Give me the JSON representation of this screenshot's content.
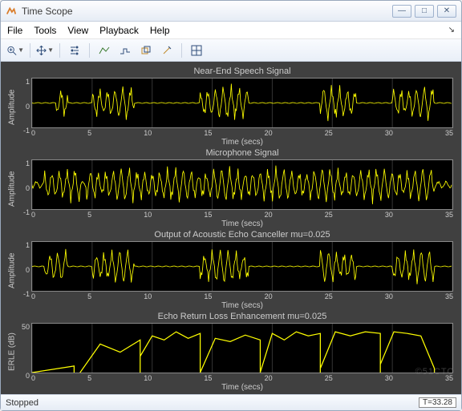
{
  "window": {
    "title": "Time Scope"
  },
  "menu": {
    "file": "File",
    "tools": "Tools",
    "view": "View",
    "playback": "Playback",
    "help": "Help"
  },
  "toolbar_icons": [
    "zoom-in",
    "pan",
    "settings",
    "line-plot",
    "step-plot",
    "overlay",
    "marker",
    "layout-grid"
  ],
  "status": {
    "left": "Stopped",
    "right": "T=33.28"
  },
  "watermark": "©51CTO",
  "xlabel": "Time (secs)",
  "xticks": [
    "0",
    "5",
    "10",
    "15",
    "20",
    "25",
    "30",
    "35"
  ],
  "plots": [
    {
      "title": "Near-End Speech Signal",
      "ylabel": "Amplitude",
      "yticks": [
        "1",
        "0",
        "-1"
      ]
    },
    {
      "title": "Microphone Signal",
      "ylabel": "Amplitude",
      "yticks": [
        "1",
        "0",
        "-1"
      ]
    },
    {
      "title": "Output of Acoustic Echo Canceller mu=0.025",
      "ylabel": "Amplitude",
      "yticks": [
        "1",
        "0",
        "-1"
      ]
    },
    {
      "title": "Echo Return Loss Enhancement mu=0.025",
      "ylabel": "ERLE (dB)",
      "yticks": [
        "50",
        "0"
      ]
    }
  ],
  "chart_data": [
    {
      "type": "line",
      "title": "Near-End Speech Signal",
      "xlabel": "Time (secs)",
      "ylabel": "Amplitude",
      "xlim": [
        0,
        35
      ],
      "ylim": [
        -1.5,
        1.5
      ],
      "x_bursts": [
        [
          2,
          3
        ],
        [
          5,
          8.5
        ],
        [
          14,
          18
        ],
        [
          24,
          27
        ],
        [
          30,
          33.5
        ]
      ],
      "amplitude": 1.0
    },
    {
      "type": "line",
      "title": "Microphone Signal",
      "xlabel": "Time (secs)",
      "ylabel": "Amplitude",
      "xlim": [
        0,
        35
      ],
      "ylim": [
        -1.5,
        1.5
      ],
      "x_bursts": [
        [
          1,
          4
        ],
        [
          4.5,
          9
        ],
        [
          9,
          14
        ],
        [
          14,
          19
        ],
        [
          19,
          24
        ],
        [
          24,
          28
        ],
        [
          28,
          33.5
        ]
      ],
      "amplitude": 1.0
    },
    {
      "type": "line",
      "title": "Output of Acoustic Echo Canceller mu=0.025",
      "xlabel": "Time (secs)",
      "ylabel": "Amplitude",
      "xlim": [
        0,
        35
      ],
      "ylim": [
        -1.5,
        1.5
      ],
      "x_bursts": [
        [
          1,
          3
        ],
        [
          5,
          8.5
        ],
        [
          14,
          18
        ],
        [
          24,
          27
        ],
        [
          30,
          33.5
        ]
      ],
      "amplitude": 1.0
    },
    {
      "type": "line",
      "title": "Echo Return Loss Enhancement mu=0.025",
      "xlabel": "Time (secs)",
      "ylabel": "ERLE (dB)",
      "xlim": [
        0,
        35
      ],
      "ylim": [
        0,
        60
      ],
      "segments": [
        {
          "x": [
            0,
            3.5
          ],
          "y": [
            0,
            8
          ]
        },
        {
          "x": [
            4,
            9
          ],
          "y": [
            0,
            35,
            25,
            40
          ]
        },
        {
          "x": [
            9,
            14
          ],
          "y": [
            20,
            45,
            40,
            50,
            42,
            48
          ]
        },
        {
          "x": [
            14,
            19
          ],
          "y": [
            0,
            42,
            38,
            46,
            40
          ]
        },
        {
          "x": [
            19,
            24
          ],
          "y": [
            0,
            48,
            40,
            50,
            45,
            48
          ]
        },
        {
          "x": [
            24,
            29
          ],
          "y": [
            5,
            50,
            45,
            50,
            48
          ]
        },
        {
          "x": [
            29,
            33.5
          ],
          "y": [
            10,
            50,
            48,
            45,
            5
          ]
        }
      ]
    }
  ]
}
